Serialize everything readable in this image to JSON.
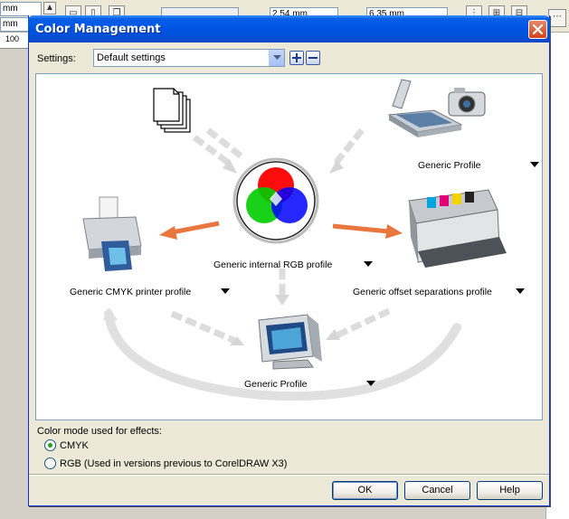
{
  "background_app": {
    "field_1": "mm",
    "field_2": "mm",
    "ruler_value": "100",
    "field_3": "2.54 mm",
    "field_4": "6.35 mm"
  },
  "dialog": {
    "title": "Color Management",
    "settings": {
      "label": "Settings:",
      "value": "Default settings"
    },
    "workflow": {
      "input_profile": "Generic Profile",
      "internal_rgb": "Generic internal RGB profile",
      "cmyk_printer": "Generic CMYK printer profile",
      "offset_separations": "Generic offset separations profile",
      "monitor_profile": "Generic Profile"
    },
    "effects": {
      "label": "Color mode used for effects:",
      "options": [
        {
          "label": "CMYK",
          "checked": true
        },
        {
          "label": "RGB (Used in versions previous to CorelDRAW X3)",
          "checked": false
        }
      ]
    },
    "buttons": {
      "ok": "OK",
      "cancel": "Cancel",
      "help": "Help"
    }
  },
  "colors": {
    "title_bar": "#0055e5",
    "arrow_orange": "#e8763e",
    "arrow_gray": "#d9d9d9"
  }
}
